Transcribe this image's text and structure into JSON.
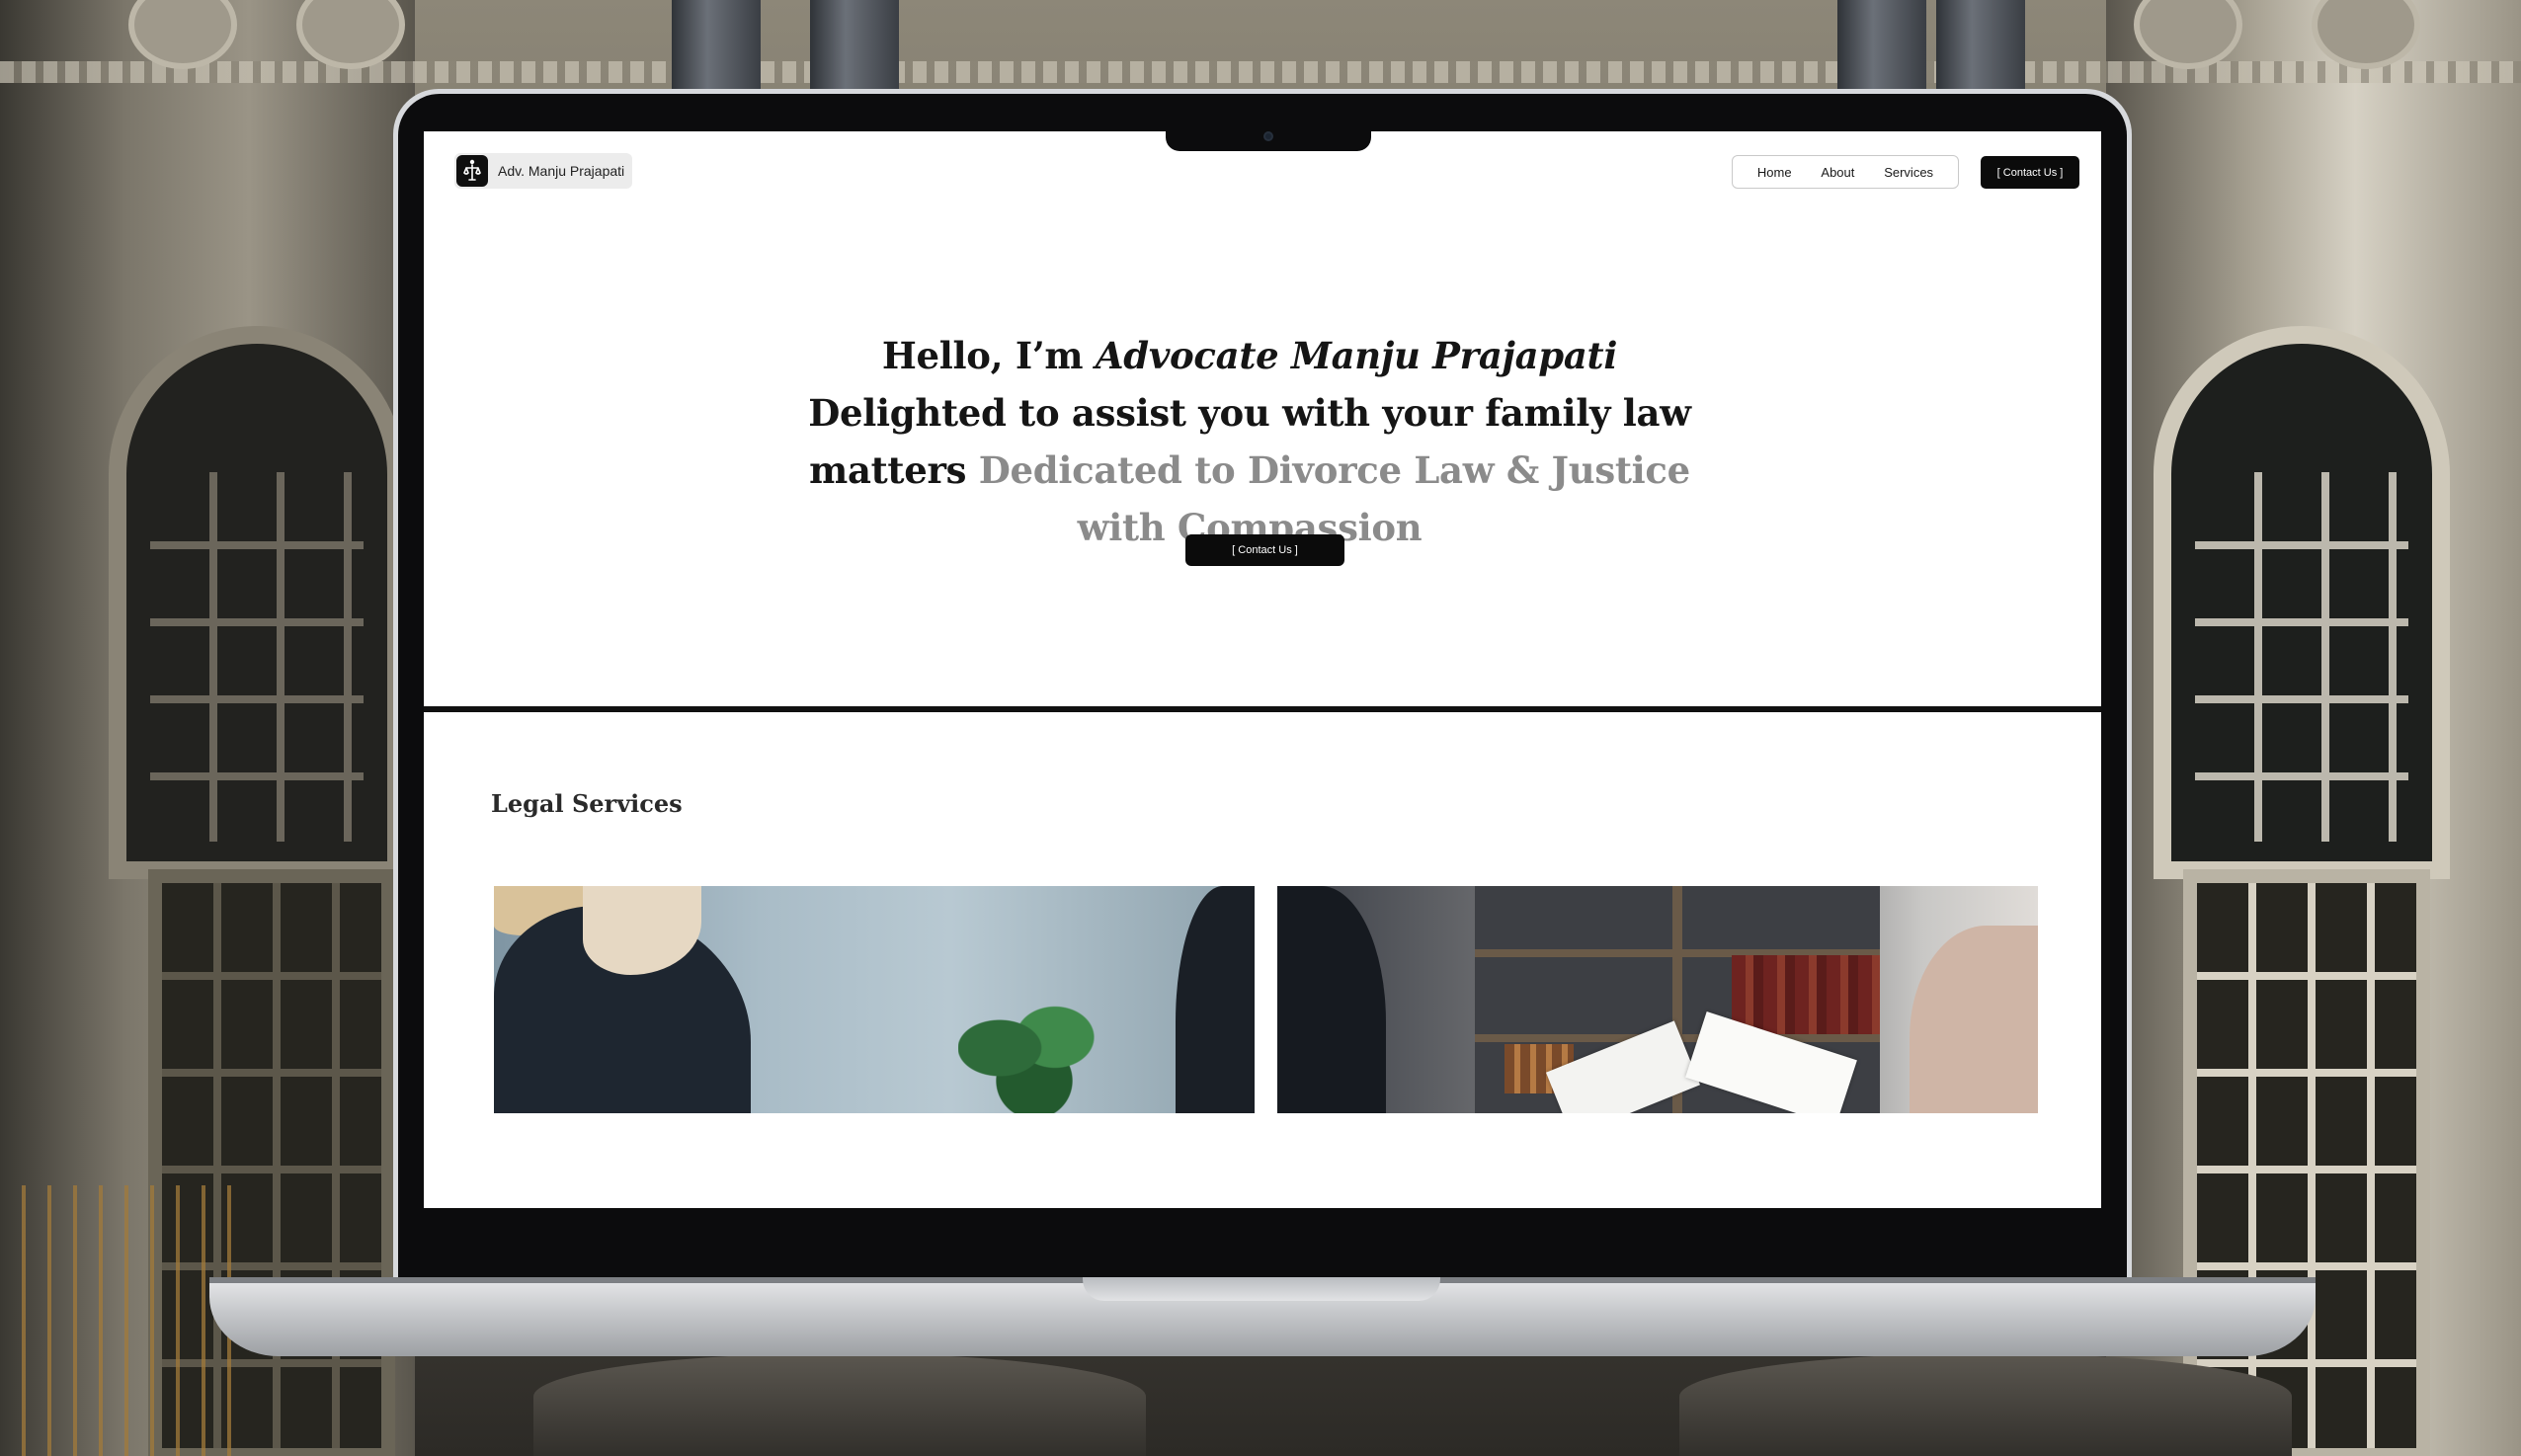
{
  "site": {
    "brand_name": "Adv. Manju Prajapati",
    "nav": {
      "links": [
        "Home",
        "About",
        "Services"
      ],
      "contact_label": "[ Contact Us ]"
    },
    "hero": {
      "headline_part1": "Hello, I’m ",
      "headline_name": "Advocate Manju Prajapati",
      "headline_part2": " Delighted to assist you with your family law matters ",
      "headline_muted": "Dedicated to Divorce Law & Justice with Compassion",
      "contact_label": "[ Contact Us ]"
    },
    "services": {
      "title": "Legal Services"
    }
  },
  "colors": {
    "primary_button": "#0b0b0b",
    "headline_text": "#151515",
    "muted_text": "#8b8b8b",
    "page_background": "#ffffff"
  },
  "icons": {
    "brand_logo": "lady-justice-icon",
    "camera": "webcam-icon"
  }
}
